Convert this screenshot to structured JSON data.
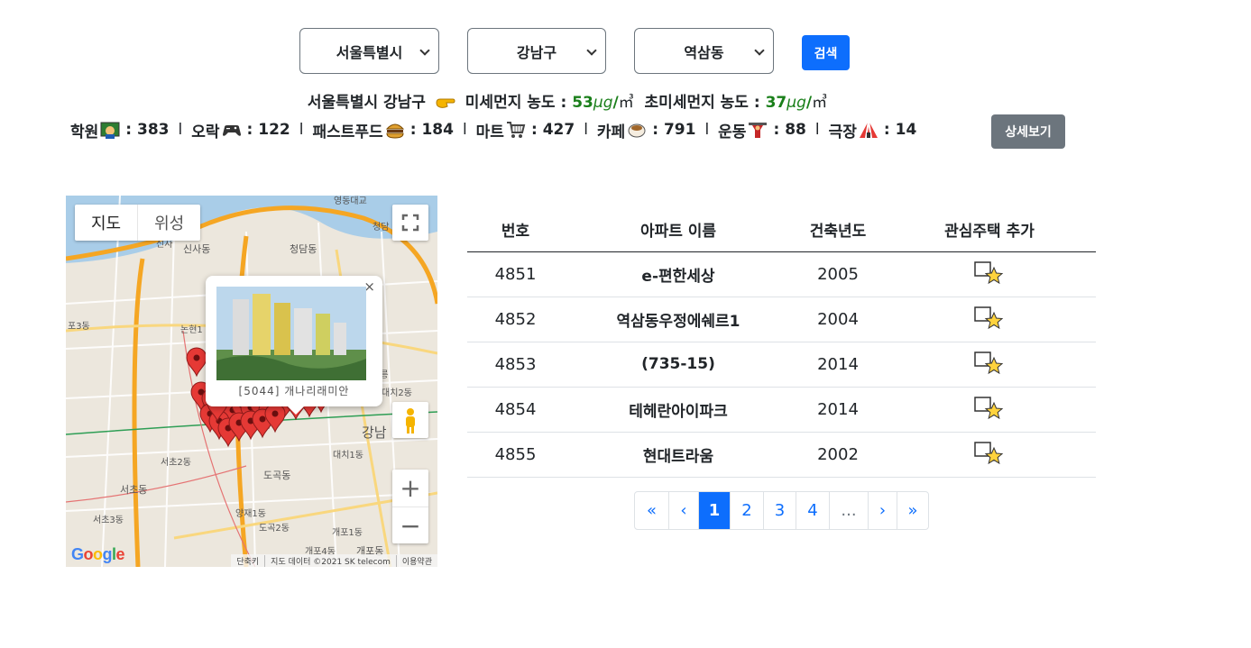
{
  "search": {
    "city": "서울특별시",
    "gu": "강남구",
    "dong": "역삼동",
    "search_label": "검색"
  },
  "dust": {
    "location": "서울특별시 강남구",
    "fine_label": "미세먼지 농도 :",
    "fine_value": "53",
    "ultrafine_label": "초미세먼지 농도 :",
    "ultrafine_value": "37",
    "unit_ug": "μg",
    "unit_slash": "/",
    "unit_m3": "㎥",
    "hand_icon": "pointing-hand-icon"
  },
  "amenities": [
    {
      "label": "학원",
      "icon": "teacher-icon",
      "count": "383"
    },
    {
      "label": "오락",
      "icon": "game-controller-icon",
      "count": "122"
    },
    {
      "label": "패스트푸드",
      "icon": "burger-icon",
      "count": "184"
    },
    {
      "label": "마트",
      "icon": "shopping-cart-icon",
      "count": "427"
    },
    {
      "label": "카페",
      "icon": "coffee-icon",
      "count": "791"
    },
    {
      "label": "운동",
      "icon": "weightlifting-icon",
      "count": "88"
    },
    {
      "label": "극장",
      "icon": "circus-tent-icon",
      "count": "14"
    }
  ],
  "amenity_colon": ":",
  "amenity_sep": "l",
  "detail_label": "상세보기",
  "map": {
    "type_map": "지도",
    "type_satellite": "위성",
    "info_caption": "[5044] 개나리래미안",
    "info_close": "×",
    "logo": "Google",
    "footer": [
      "단축키",
      "지도 데이터 ©2021 SK telecom",
      "이용약관"
    ],
    "zoom_in": "+",
    "zoom_out": "−",
    "place_labels": [
      "영동대교",
      "청담",
      "신사동",
      "청담동",
      "논현1",
      "포3동",
      "선정릉",
      "강남",
      "대치1동",
      "서초2동",
      "도곡동",
      "서초동",
      "서초3동",
      "도곡2동",
      "개포1동",
      "양재1동",
      "개포4동",
      "개포동",
      "신사",
      "대치2동"
    ]
  },
  "table": {
    "headers": [
      "번호",
      "아파트 이름",
      "건축년도",
      "관심주택 추가"
    ],
    "rows": [
      {
        "no": "4851",
        "name": "e-편한세상",
        "year": "2005"
      },
      {
        "no": "4852",
        "name": "역삼동우정에쉐르1",
        "year": "2004"
      },
      {
        "no": "4853",
        "name": "(735-15)",
        "year": "2014"
      },
      {
        "no": "4854",
        "name": "테헤란아이파크",
        "year": "2014"
      },
      {
        "no": "4855",
        "name": "현대트라움",
        "year": "2002"
      }
    ],
    "fav_icon": "star-checkbox-icon"
  },
  "pagination": [
    "«",
    "‹",
    "1",
    "2",
    "3",
    "4",
    "...",
    "›",
    "»"
  ],
  "pagination_active": "1",
  "colors": {
    "primary": "#0d6efd",
    "secondary": "#6c757d",
    "dust_value": "#1a7f1a",
    "marker": "#e53935"
  }
}
